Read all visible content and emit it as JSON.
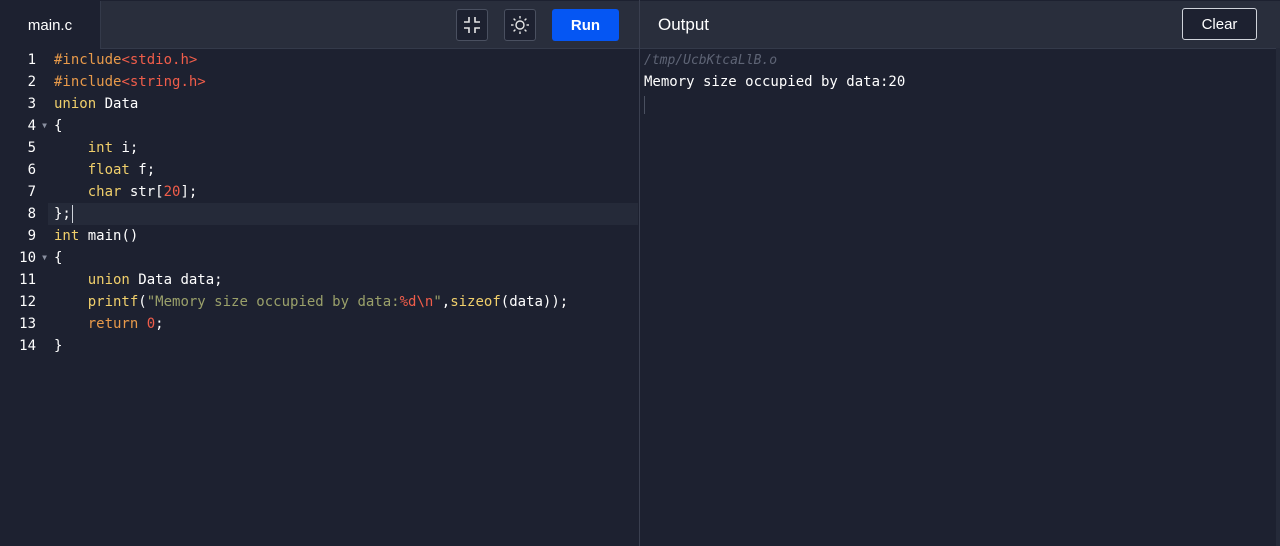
{
  "editor": {
    "file_tab": "main.c",
    "toolbar": {
      "minimize_icon": "minimize-icon",
      "theme_icon": "sun-icon",
      "run_label": "Run"
    },
    "line_numbers": [
      "1",
      "2",
      "3",
      "4",
      "5",
      "6",
      "7",
      "8",
      "9",
      "10",
      "11",
      "12",
      "13",
      "14"
    ],
    "folded_lines": [
      4,
      10
    ]
  },
  "output": {
    "title": "Output",
    "clear_label": "Clear",
    "path": "/tmp/UcbKtcaLlB.o",
    "text": "Memory size occupied by data:20"
  },
  "colors": {
    "run_button": "#0556f3",
    "background": "#1d2130",
    "header": "#292e3c",
    "keyword": "#f0cf6b",
    "string": "#9aa06a",
    "number": "#f05d4a"
  }
}
